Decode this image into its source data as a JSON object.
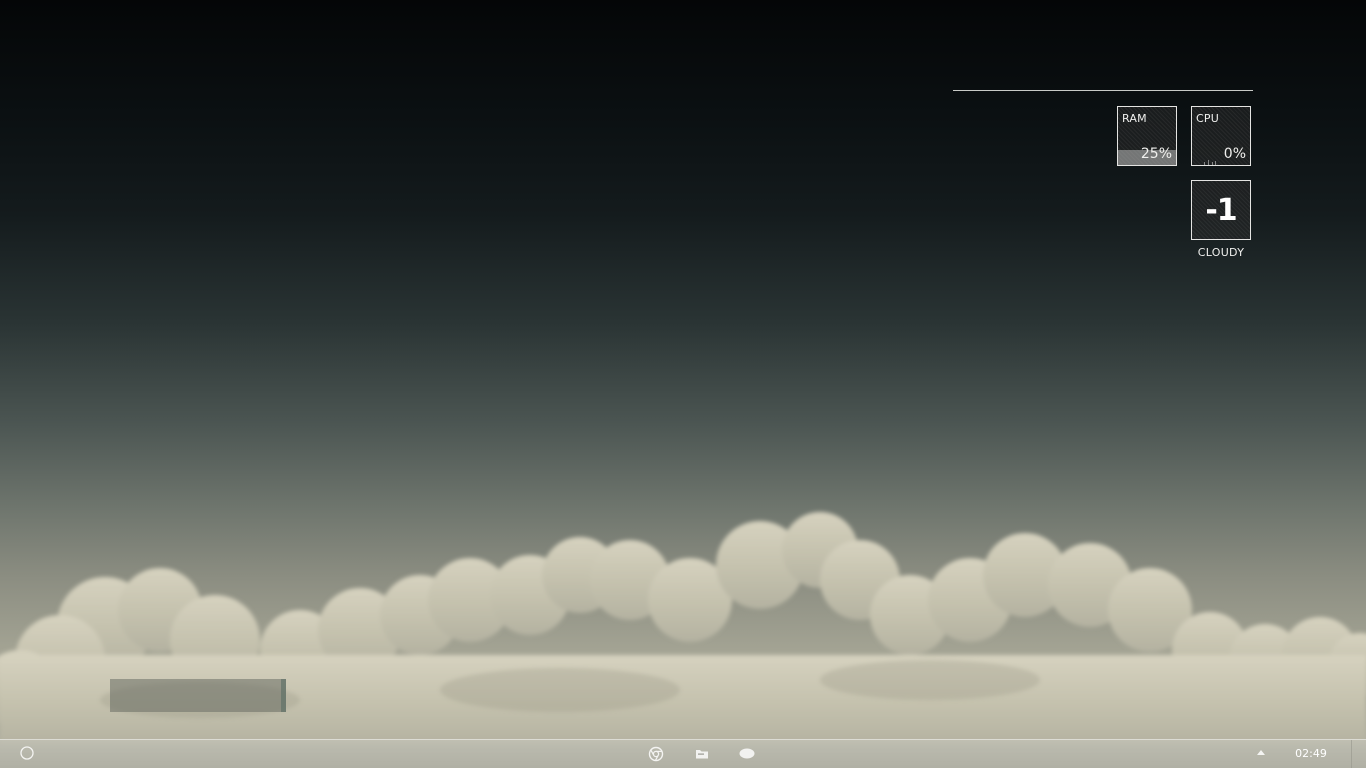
{
  "widgets": {
    "ram": {
      "label": "RAM",
      "value": "25%",
      "usage_fraction": 0.25
    },
    "cpu": {
      "label": "CPU",
      "value": "0%",
      "usage_fraction": 0.0
    },
    "weather": {
      "temperature": "-1",
      "condition": "CLOUDY"
    }
  },
  "taskbar": {
    "start_icon": "start-orb-icon",
    "pinned_apps": [
      {
        "name": "Google Chrome",
        "icon": "chrome-icon"
      },
      {
        "name": "File Explorer",
        "icon": "folder-icon"
      },
      {
        "name": "Chat",
        "icon": "chat-bubble-icon"
      }
    ],
    "tray_icon": "tray-expand-arrow-icon",
    "clock": "02:49"
  },
  "colors": {
    "widget_border": "#e4e4e2",
    "widget_text": "#f0f0ee",
    "sky_top": "#040607",
    "cloud": "#cfcbb8"
  }
}
